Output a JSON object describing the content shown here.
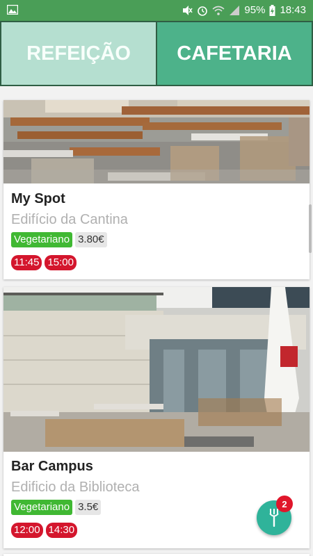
{
  "status_bar": {
    "icons": [
      "gallery-icon",
      "mute-icon",
      "alarm-icon",
      "wifi-icon",
      "signal-icon",
      "battery-icon"
    ],
    "battery": "95%",
    "time": "18:43"
  },
  "tabs": [
    {
      "label": "REFEIÇÃO",
      "active": false
    },
    {
      "label": "CAFETARIA",
      "active": true
    }
  ],
  "places": [
    {
      "name": "My Spot",
      "location": "Edifício da Cantina",
      "tags": [
        "Vegetariano",
        "3.80€"
      ],
      "times": [
        "11:45",
        "15:00"
      ]
    },
    {
      "name": "Bar Campus",
      "location": "Edificio da Biblioteca",
      "tags": [
        "Vegetariano",
        "3.5€"
      ],
      "times": [
        "12:00",
        "14:30"
      ]
    }
  ],
  "fab": {
    "icon": "fork-icon",
    "badge": "2"
  },
  "colors": {
    "status_bar": "#4a9e57",
    "tab_active": "#4db28a",
    "tab_inactive": "#b5dfd0",
    "veg_tag": "#40b833",
    "time_badge": "#d4162d",
    "fab": "#2fb39a"
  }
}
